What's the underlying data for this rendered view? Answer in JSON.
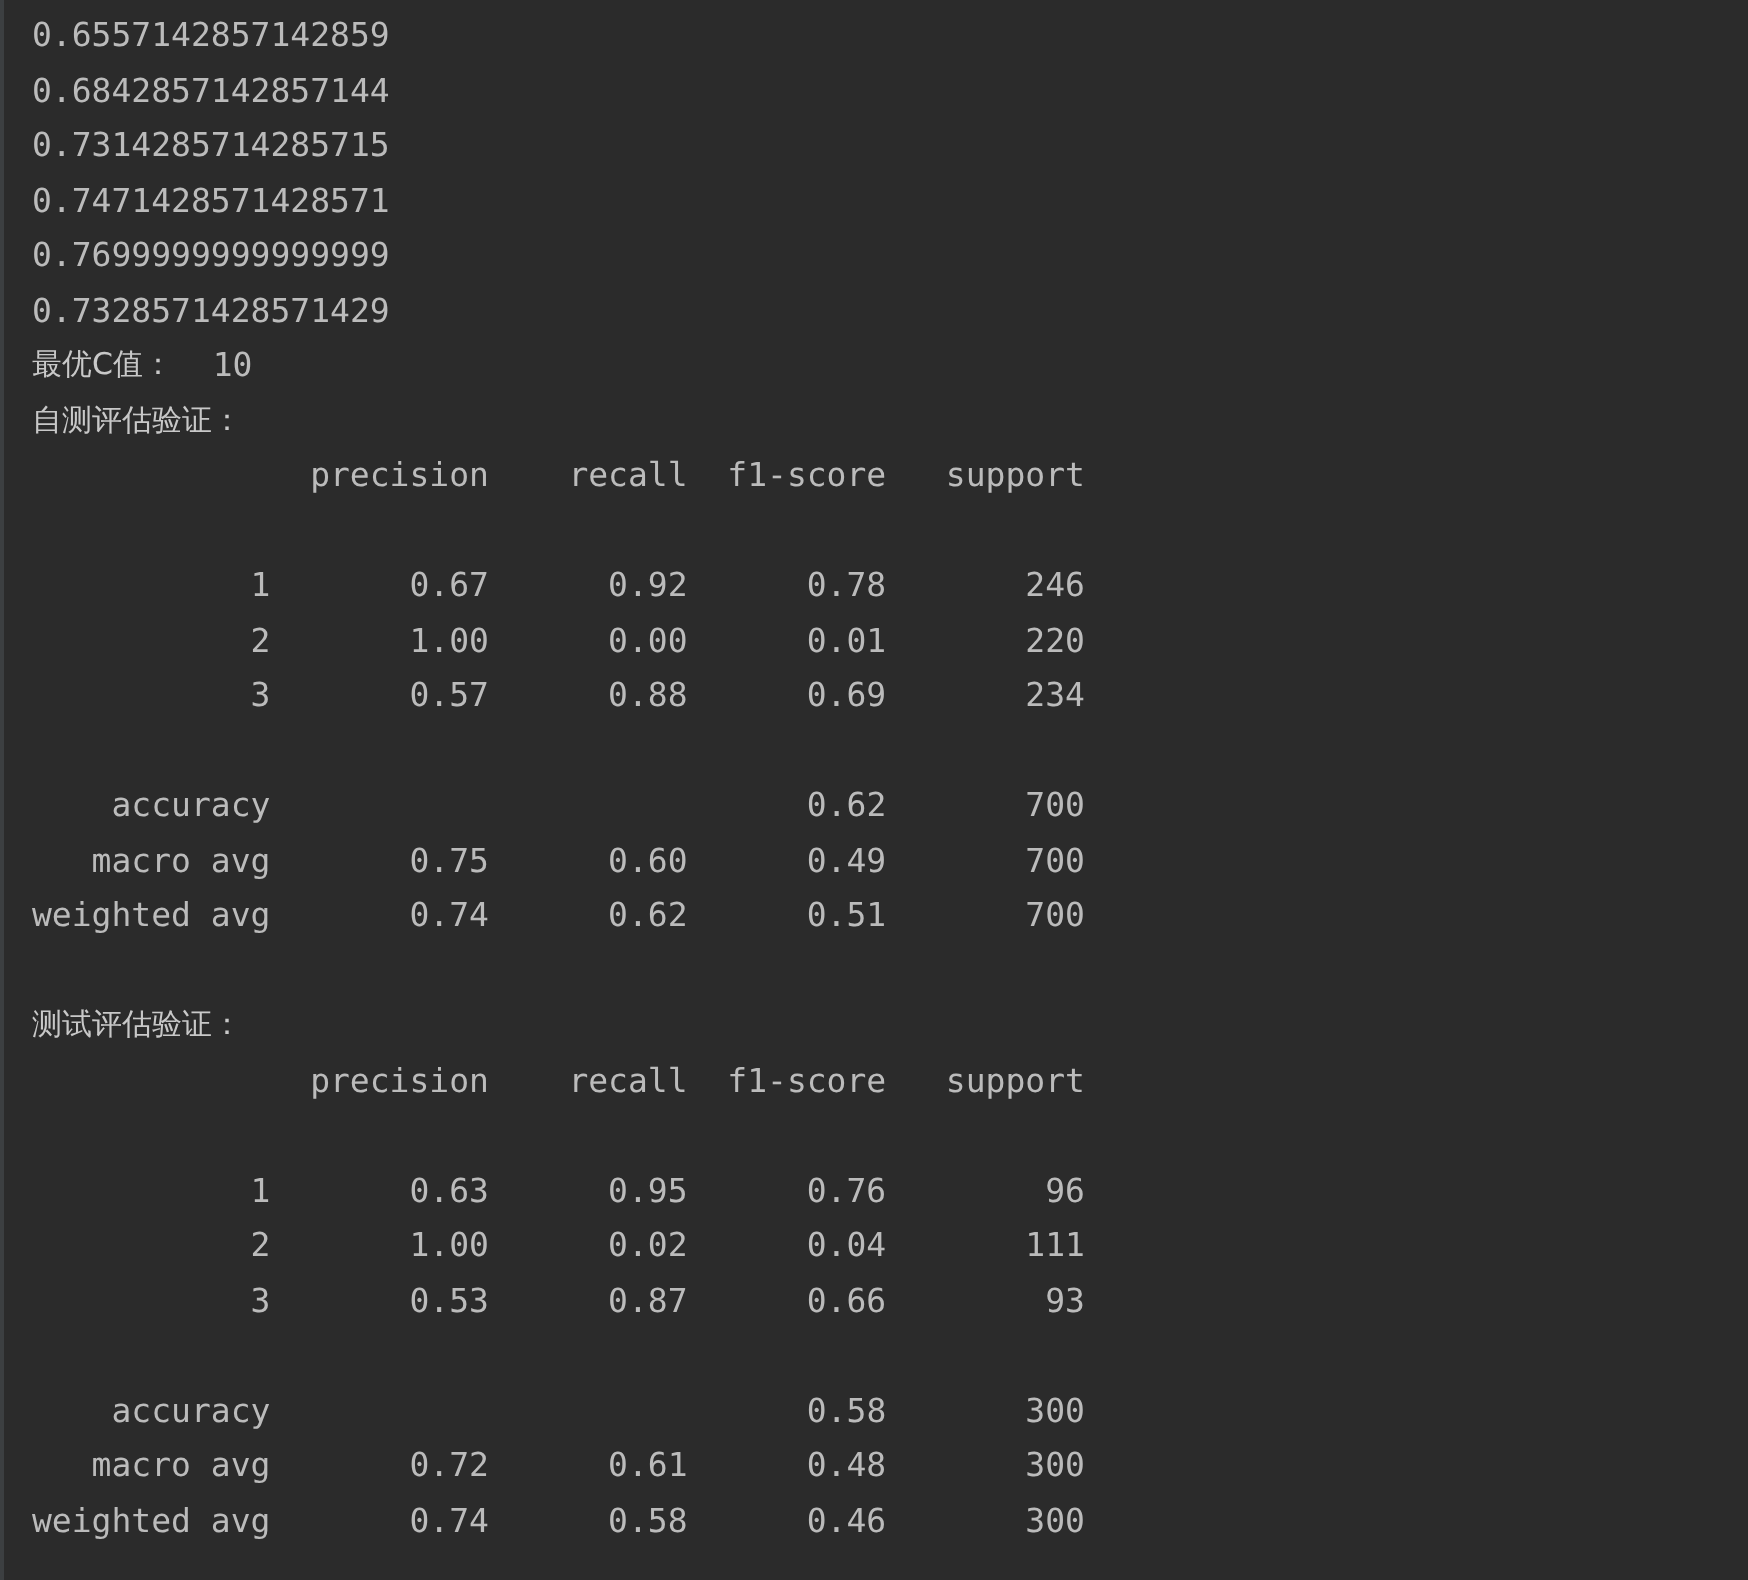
{
  "console": {
    "values": [
      "0.6557142857142859",
      "0.6842857142857144",
      "0.7314285714285715",
      "0.7471428571428571",
      "0.7699999999999999",
      "0.7328571428571429"
    ],
    "best_c": {
      "label": "最优C值：",
      "value": "10"
    },
    "reports": [
      {
        "title": "自测评估验证：",
        "columns": [
          "precision",
          "recall",
          "f1-score",
          "support"
        ],
        "classes": [
          {
            "label": "1",
            "cells": [
              "0.67",
              "0.92",
              "0.78",
              "246"
            ]
          },
          {
            "label": "2",
            "cells": [
              "1.00",
              "0.00",
              "0.01",
              "220"
            ]
          },
          {
            "label": "3",
            "cells": [
              "0.57",
              "0.88",
              "0.69",
              "234"
            ]
          }
        ],
        "summary": [
          {
            "kind": "accuracy",
            "label": "accuracy",
            "cells": [
              "0.62",
              "700"
            ]
          },
          {
            "kind": "average",
            "label": "macro avg",
            "cells": [
              "0.75",
              "0.60",
              "0.49",
              "700"
            ]
          },
          {
            "kind": "average",
            "label": "weighted avg",
            "cells": [
              "0.74",
              "0.62",
              "0.51",
              "700"
            ]
          }
        ]
      },
      {
        "title": "测试评估验证：",
        "columns": [
          "precision",
          "recall",
          "f1-score",
          "support"
        ],
        "classes": [
          {
            "label": "1",
            "cells": [
              "0.63",
              "0.95",
              "0.76",
              "96"
            ]
          },
          {
            "label": "2",
            "cells": [
              "1.00",
              "0.02",
              "0.04",
              "111"
            ]
          },
          {
            "label": "3",
            "cells": [
              "0.53",
              "0.87",
              "0.66",
              "93"
            ]
          }
        ],
        "summary": [
          {
            "kind": "accuracy",
            "label": "accuracy",
            "cells": [
              "0.58",
              "300"
            ]
          },
          {
            "kind": "average",
            "label": "macro avg",
            "cells": [
              "0.72",
              "0.61",
              "0.48",
              "300"
            ]
          },
          {
            "kind": "average",
            "label": "weighted avg",
            "cells": [
              "0.74",
              "0.58",
              "0.46",
              "300"
            ]
          }
        ]
      }
    ]
  }
}
